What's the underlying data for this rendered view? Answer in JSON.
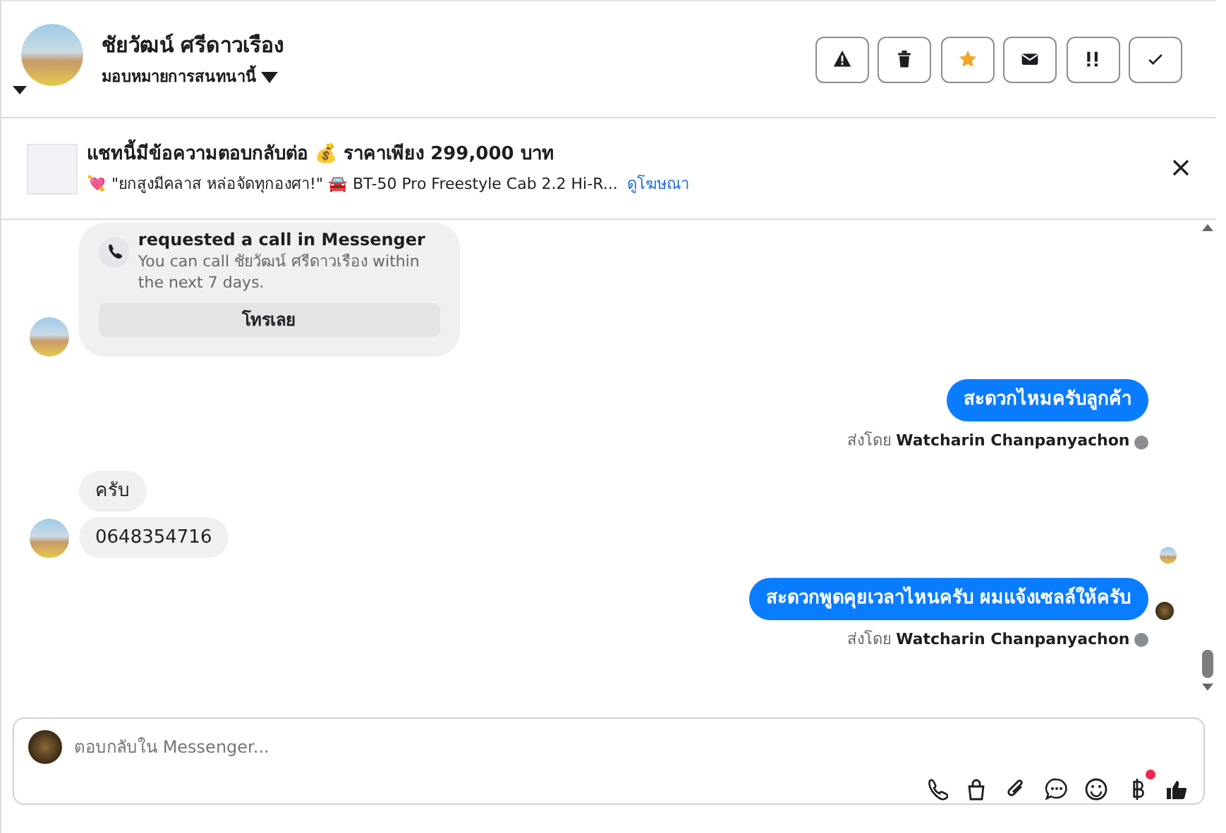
{
  "contact": {
    "name": "ชัยวัฒน์ ศรีดาวเรือง",
    "assign_label": "มอบหมายการสนทนานี้"
  },
  "actions": [
    {
      "kind": "warning"
    },
    {
      "kind": "trash"
    },
    {
      "kind": "star"
    },
    {
      "kind": "envelope"
    },
    {
      "kind": "exclaim"
    },
    {
      "kind": "check"
    }
  ],
  "ad_banner": {
    "title": "แชทนี้มีข้อความตอบกลับต่อ 💰 ราคาเพียง 299,000 บาท",
    "subtitle": "💘 \"ยกสูงมีคลาส หล่อจัดทุกองศา!\" 🚘 BT-50 Pro Freestyle Cab 2.2 Hi-R...",
    "link": "ดูโฆษณา"
  },
  "messages": [
    {
      "kind": "call_request",
      "title": "requested a call in Messenger",
      "body": "You can call ชัยวัฒน์ ศรีดาวเรือง within the next 7 days.",
      "action": "โทรเลย"
    },
    {
      "kind": "outgoing",
      "text": "สะดวกไหมครับลูกค้า",
      "sent_by_label": "ส่งโดย",
      "sender": "Watcharin Chanpanyachon",
      "page_avatar": false
    },
    {
      "kind": "incoming",
      "bubbles": [
        "ครับ",
        "0648354716"
      ]
    },
    {
      "kind": "read_receipt"
    },
    {
      "kind": "outgoing",
      "text": "สะดวกพูดคุยเวลาไหนครับ ผมแจ้งเซลล์ให้ครับ",
      "sent_by_label": "ส่งโดย",
      "sender": "Watcharin Chanpanyachon",
      "page_avatar": true
    }
  ],
  "composer": {
    "placeholder": "ตอบกลับใน Messenger...",
    "tools": [
      {
        "kind": "phone",
        "dot": false
      },
      {
        "kind": "bag",
        "dot": false
      },
      {
        "kind": "clip",
        "dot": false
      },
      {
        "kind": "chat",
        "dot": false
      },
      {
        "kind": "smiley",
        "dot": false
      },
      {
        "kind": "baht",
        "dot": true
      },
      {
        "kind": "like",
        "dot": false
      }
    ]
  }
}
